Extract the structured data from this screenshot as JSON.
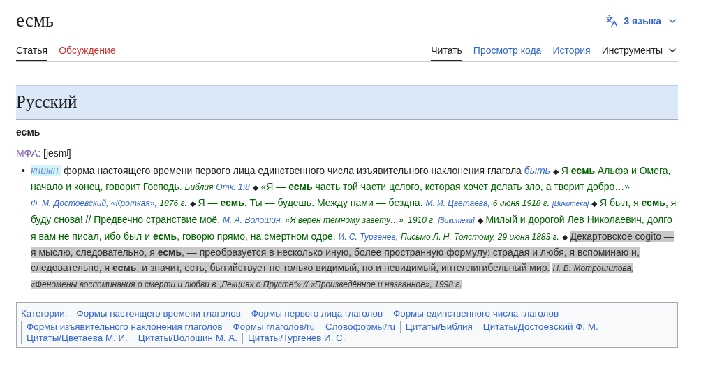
{
  "page": {
    "title": "есмь",
    "languages_button": "3 языка"
  },
  "tabs_left": [
    {
      "label": "Статья",
      "selected": true,
      "missing": false
    },
    {
      "label": "Обсуждение",
      "selected": false,
      "missing": true
    }
  ],
  "tabs_right": [
    {
      "label": "Читать",
      "selected": true,
      "kind": "tab"
    },
    {
      "label": "Просмотр кода",
      "selected": false,
      "kind": "tab"
    },
    {
      "label": "История",
      "selected": false,
      "kind": "tab"
    },
    {
      "label": "Инструменты",
      "selected": false,
      "kind": "menu"
    }
  ],
  "section": {
    "heading": "Русский",
    "headword": "есмь",
    "ipa_label": "МФА:",
    "ipa": "[jesmʲ]",
    "bullet": "•"
  },
  "definition": [
    {
      "kind": "label",
      "text": "книжн.",
      "selected": false
    },
    {
      "kind": "text",
      "text": "форма настоящего времени первого лица единственного числа изъявительного наклонения глагола",
      "selected": false
    },
    {
      "kind": "link",
      "text": "быть",
      "selected": false
    },
    {
      "kind": "sep",
      "text": "◆",
      "selected": false
    },
    {
      "kind": "quote",
      "text": "Я **есмь** Альфа и Омега, начало и конец, говорит Господь.",
      "selected": false
    },
    {
      "kind": "cite-text",
      "text": "Библия",
      "selected": false
    },
    {
      "kind": "cite-link",
      "text": "Отк. 1:8",
      "selected": false
    },
    {
      "kind": "sep",
      "text": "◆",
      "selected": false
    },
    {
      "kind": "quote",
      "text": "«Я — **есмь** часть той части целого, которая хочет делать зло, а творит добро…»",
      "selected": false
    },
    {
      "kind": "cite-link",
      "text": "Ф. М. Достоевский, «Кроткая»,",
      "selected": false
    },
    {
      "kind": "cite-text",
      "text": "1876 г.",
      "selected": false
    },
    {
      "kind": "sep",
      "text": "◆",
      "selected": false
    },
    {
      "kind": "quote",
      "text": "Я — **есмь**. Ты — будешь. Между нами — бездна.",
      "selected": false
    },
    {
      "kind": "cite-link",
      "text": "М. И. Цветаева,",
      "selected": false
    },
    {
      "kind": "cite-text",
      "text": "6 июня 1918 г.",
      "selected": false
    },
    {
      "kind": "wikisource",
      "text": "[Викитека]",
      "selected": false
    },
    {
      "kind": "sep",
      "text": "◆",
      "selected": false
    },
    {
      "kind": "quote",
      "text": "Я был, я **есмь**, я буду снова! // Предвечно странствие моё.",
      "selected": false
    },
    {
      "kind": "cite-link",
      "text": "М. А. Волошин,",
      "selected": false
    },
    {
      "kind": "cite-text",
      "text": "«Я верен тёмному завету…», 1910 г.",
      "selected": false
    },
    {
      "kind": "wikisource",
      "text": "[Викитека]",
      "selected": false
    },
    {
      "kind": "sep",
      "text": "◆",
      "selected": false
    },
    {
      "kind": "quote",
      "text": "Милый и дорогой Лев Николаевич, долго я вам не писал, ибо был и **есмь**, говорю прямо, на смертном одре.",
      "selected": false
    },
    {
      "kind": "cite-link",
      "text": "И. С. Тургенев,",
      "selected": false
    },
    {
      "kind": "cite-text",
      "text": "Письмо Л. Н. Толстому, 29 июня 1883 г.",
      "selected": false
    },
    {
      "kind": "sep",
      "text": "◆",
      "selected": false
    },
    {
      "kind": "quote",
      "text": "Декартовское cogito — я мыслю, следовательно, я **есмь**, — преобразуется в несколько иную, более пространную формулу: страдая и любя, я вспоминаю и, следовательно, я **есмь**, и значит, есть, бытийствует не только видимый, но и невидимый, интеллигибельный мир.",
      "selected": true
    },
    {
      "kind": "cite-text",
      "text": "Н. В. Мотрошилова, «Феномены воспоминания о смерти и любви в „Лекциях о Прусте“» // «Произведённое и названное», 1998 г.",
      "selected": true
    }
  ],
  "categories": {
    "label": "Категории:",
    "items": [
      "Формы настоящего времени глаголов",
      "Формы первого лица глаголов",
      "Формы единственного числа глаголов",
      "Формы изъявительного наклонения глаголов",
      "Формы глаголов/ru",
      "Словоформы/ru",
      "Цитаты/Библия",
      "Цитаты/Достоевский Ф. М.",
      "Цитаты/Цветаева М. И.",
      "Цитаты/Волошин М. А.",
      "Цитаты/Тургенев И. С."
    ]
  }
}
